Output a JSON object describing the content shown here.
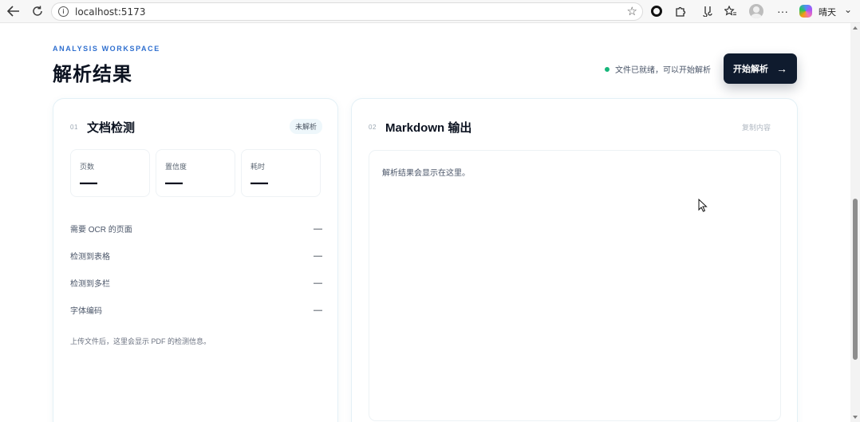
{
  "browser": {
    "url": "localhost:5173",
    "profile_name": "晴天",
    "icons": [
      "back-arrow-icon",
      "reload-icon",
      "info-icon",
      "star-icon",
      "extension-circle-icon",
      "puzzle-icon",
      "sync-icon",
      "favorites-icon",
      "avatar",
      "more-icon",
      "copilot-icon",
      "chevron-down-icon"
    ]
  },
  "header": {
    "eyebrow": "ANALYSIS WORKSPACE",
    "title": "解析结果",
    "status_text": "文件已就绪，可以开始解析",
    "status_color": "#16b67a",
    "start_button_label": "开始解析",
    "start_button_arrow": "→"
  },
  "detection_panel": {
    "number": "01",
    "title": "文档检测",
    "badge": "未解析",
    "stats": [
      {
        "label": "页数",
        "value": "—"
      },
      {
        "label": "置信度",
        "value": "—"
      },
      {
        "label": "耗时",
        "value": "—"
      }
    ],
    "rows": [
      {
        "label": "需要 OCR 的页面",
        "value": "—"
      },
      {
        "label": "检测到表格",
        "value": "—"
      },
      {
        "label": "检测到多栏",
        "value": "—"
      },
      {
        "label": "字体编码",
        "value": "—"
      }
    ],
    "hint": "上传文件后，这里会显示 PDF 的检测信息。"
  },
  "output_panel": {
    "number": "02",
    "title": "Markdown 输出",
    "copy_label": "复制内容",
    "placeholder": "解析结果会显示在这里。"
  },
  "colors": {
    "accent_blue": "#2f6fcf",
    "primary_dark": "#0f1b2e"
  }
}
